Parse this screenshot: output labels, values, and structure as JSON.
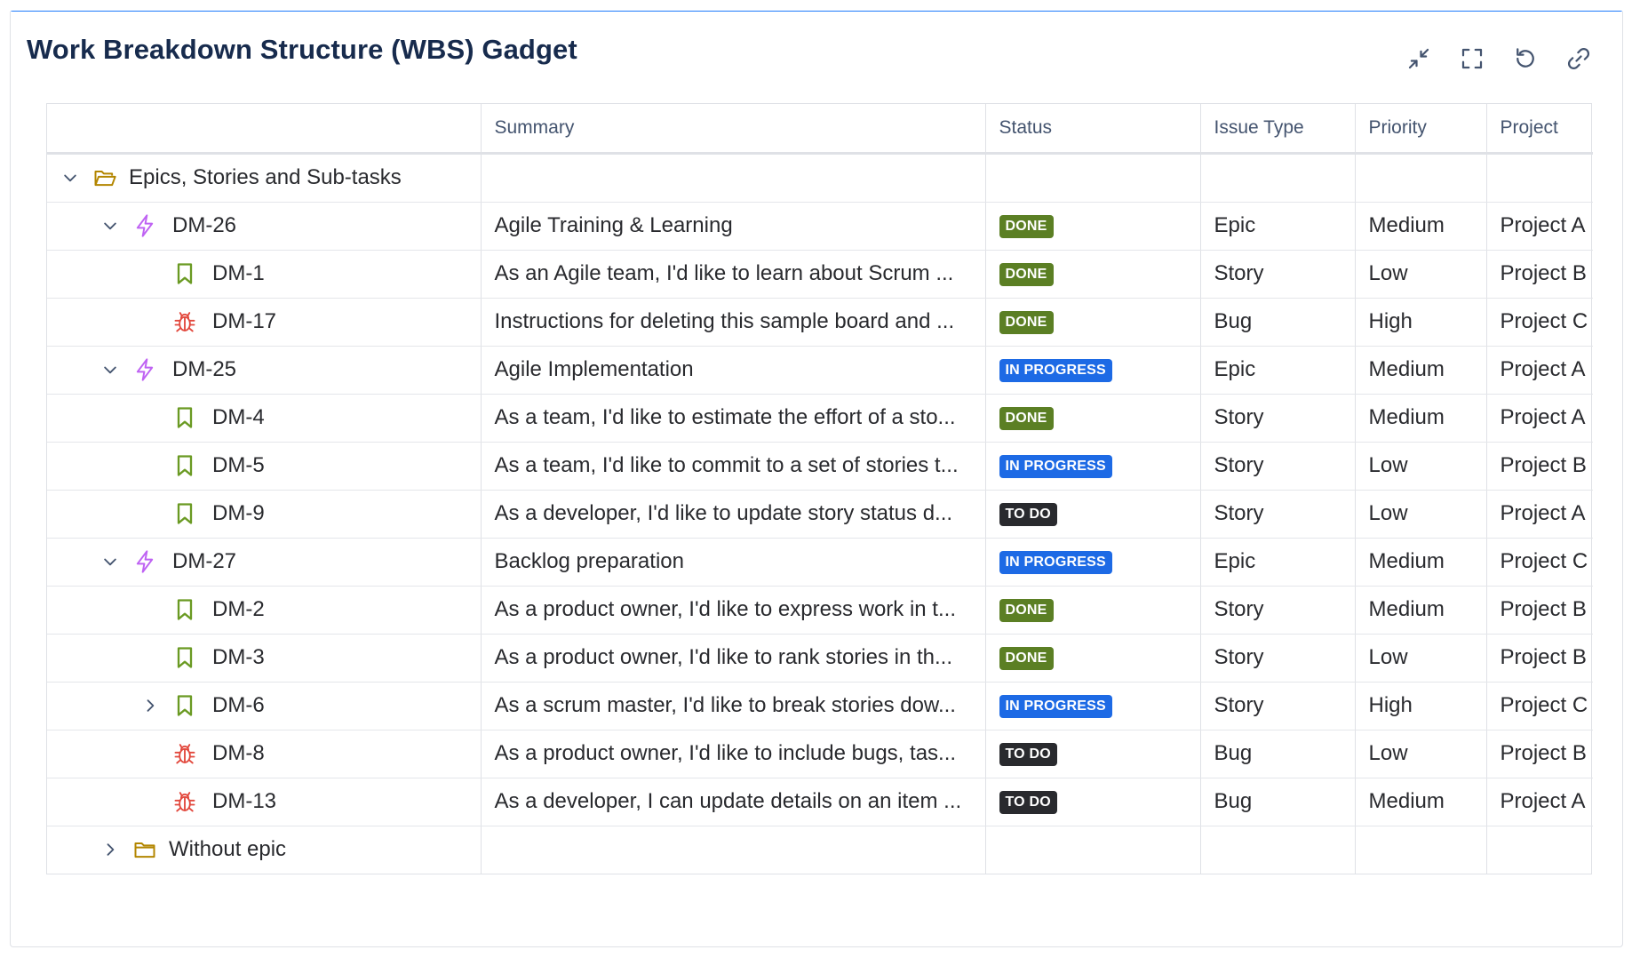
{
  "gadget": {
    "title": "Work Breakdown Structure (WBS) Gadget",
    "accent_color": "#1d7afc",
    "toolbar": [
      {
        "name": "collapse-icon",
        "action": "collapse"
      },
      {
        "name": "fullscreen-icon",
        "action": "fullscreen"
      },
      {
        "name": "refresh-icon",
        "action": "refresh"
      },
      {
        "name": "link-icon",
        "action": "link"
      }
    ]
  },
  "table": {
    "columns": [
      "",
      "Summary",
      "Status",
      "Issue Type",
      "Priority",
      "Project"
    ],
    "status_colors": {
      "DONE": "#5b7f24",
      "IN PROGRESS": "#1d6ae5",
      "TO DO": "#292a2e"
    },
    "icon_colors": {
      "folder": "#b38600",
      "epic": "#bf63f3",
      "story": "#6a9a23",
      "bug": "#e2483d",
      "chevron": "#44546f"
    },
    "rows": [
      {
        "level": 0,
        "chevron": "down",
        "icon": "folder-open",
        "key": "Epics, Stories and Sub-tasks",
        "summary": "",
        "status": "",
        "issue_type": "",
        "priority": "",
        "project": ""
      },
      {
        "level": 1,
        "chevron": "down",
        "icon": "epic",
        "key": "DM-26",
        "summary": "Agile Training & Learning",
        "status": "DONE",
        "issue_type": "Epic",
        "priority": "Medium",
        "project": "Project A"
      },
      {
        "level": 2,
        "chevron": "",
        "icon": "story",
        "key": "DM-1",
        "summary": "As an Agile team, I'd like to learn about Scrum ...",
        "status": "DONE",
        "issue_type": "Story",
        "priority": "Low",
        "project": "Project B"
      },
      {
        "level": 2,
        "chevron": "",
        "icon": "bug",
        "key": "DM-17",
        "summary": "Instructions for deleting this sample board and ...",
        "status": "DONE",
        "issue_type": "Bug",
        "priority": "High",
        "project": "Project C"
      },
      {
        "level": 1,
        "chevron": "down",
        "icon": "epic",
        "key": "DM-25",
        "summary": "Agile Implementation",
        "status": "IN PROGRESS",
        "issue_type": "Epic",
        "priority": "Medium",
        "project": "Project A"
      },
      {
        "level": 2,
        "chevron": "",
        "icon": "story",
        "key": "DM-4",
        "summary": "As a team, I'd like to estimate the effort of a sto...",
        "status": "DONE",
        "issue_type": "Story",
        "priority": "Medium",
        "project": "Project A"
      },
      {
        "level": 2,
        "chevron": "",
        "icon": "story",
        "key": "DM-5",
        "summary": "As a team, I'd like to commit to a set of stories t...",
        "status": "IN PROGRESS",
        "issue_type": "Story",
        "priority": "Low",
        "project": "Project B"
      },
      {
        "level": 2,
        "chevron": "",
        "icon": "story",
        "key": "DM-9",
        "summary": "As a developer, I'd like to update story status d...",
        "status": "TO DO",
        "issue_type": "Story",
        "priority": "Low",
        "project": "Project A"
      },
      {
        "level": 1,
        "chevron": "down",
        "icon": "epic",
        "key": "DM-27",
        "summary": "Backlog preparation",
        "status": "IN PROGRESS",
        "issue_type": "Epic",
        "priority": "Medium",
        "project": "Project C"
      },
      {
        "level": 2,
        "chevron": "",
        "icon": "story",
        "key": "DM-2",
        "summary": "As a product owner, I'd like to express work in t...",
        "status": "DONE",
        "issue_type": "Story",
        "priority": "Medium",
        "project": "Project B"
      },
      {
        "level": 2,
        "chevron": "",
        "icon": "story",
        "key": "DM-3",
        "summary": "As a product owner, I'd like to rank stories in th...",
        "status": "DONE",
        "issue_type": "Story",
        "priority": "Low",
        "project": "Project B"
      },
      {
        "level": 2,
        "chevron": "right",
        "icon": "story",
        "key": "DM-6",
        "summary": "As a scrum master, I'd like to break stories dow...",
        "status": "IN PROGRESS",
        "issue_type": "Story",
        "priority": "High",
        "project": "Project C"
      },
      {
        "level": 2,
        "chevron": "",
        "icon": "bug",
        "key": "DM-8",
        "summary": "As a product owner, I'd like to include bugs, tas...",
        "status": "TO DO",
        "issue_type": "Bug",
        "priority": "Low",
        "project": "Project B"
      },
      {
        "level": 2,
        "chevron": "",
        "icon": "bug",
        "key": "DM-13",
        "summary": "As a developer, I can update details on an item ...",
        "status": "TO DO",
        "issue_type": "Bug",
        "priority": "Medium",
        "project": "Project A"
      },
      {
        "level": 1,
        "chevron": "right",
        "icon": "folder",
        "key": "Without epic",
        "summary": "",
        "status": "",
        "issue_type": "",
        "priority": "",
        "project": ""
      }
    ]
  }
}
